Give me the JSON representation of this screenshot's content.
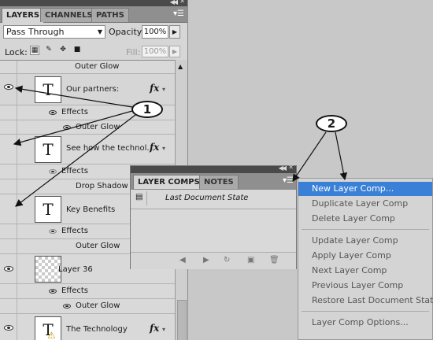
{
  "layers_panel": {
    "tabs": [
      "LAYERS",
      "CHANNELS",
      "PATHS"
    ],
    "blend_mode": "Pass Through",
    "opacity_label": "Opacity:",
    "opacity_value": "100%",
    "lock_label": "Lock:",
    "fill_label": "Fill:",
    "fill_value": "100%",
    "rows": {
      "outer_glow_top": "Outer Glow",
      "our_partners": "Our partners:",
      "effects_1": "Effects",
      "outer_glow_1": "Outer Glow",
      "see_how": "See how the technol...",
      "effects_2": "Effects",
      "drop_shadow": "Drop Shadow",
      "key_benefits": "Key Benefits",
      "effects_3": "Effects",
      "outer_glow_3": "Outer Glow",
      "layer_36": "Layer 36",
      "effects_4": "Effects",
      "outer_glow_4": "Outer Glow",
      "the_technology": "The Technology",
      "thumb_text": "T",
      "fx": "fx"
    }
  },
  "comps_panel": {
    "tabs": [
      "LAYER COMPS",
      "NOTES"
    ],
    "state": "Last Document State"
  },
  "flyout_menu": {
    "items": [
      "New Layer Comp...",
      "Duplicate Layer Comp",
      "Delete Layer Comp",
      "Update Layer Comp",
      "Apply Layer Comp",
      "Next Layer Comp",
      "Previous Layer Comp",
      "Restore Last Document State",
      "Layer Comp Options..."
    ]
  },
  "callouts": [
    "1",
    "2"
  ],
  "colors": {
    "highlight": "#3a80d6",
    "panel": "#d6d6d6",
    "background": "#c8c8c8"
  }
}
